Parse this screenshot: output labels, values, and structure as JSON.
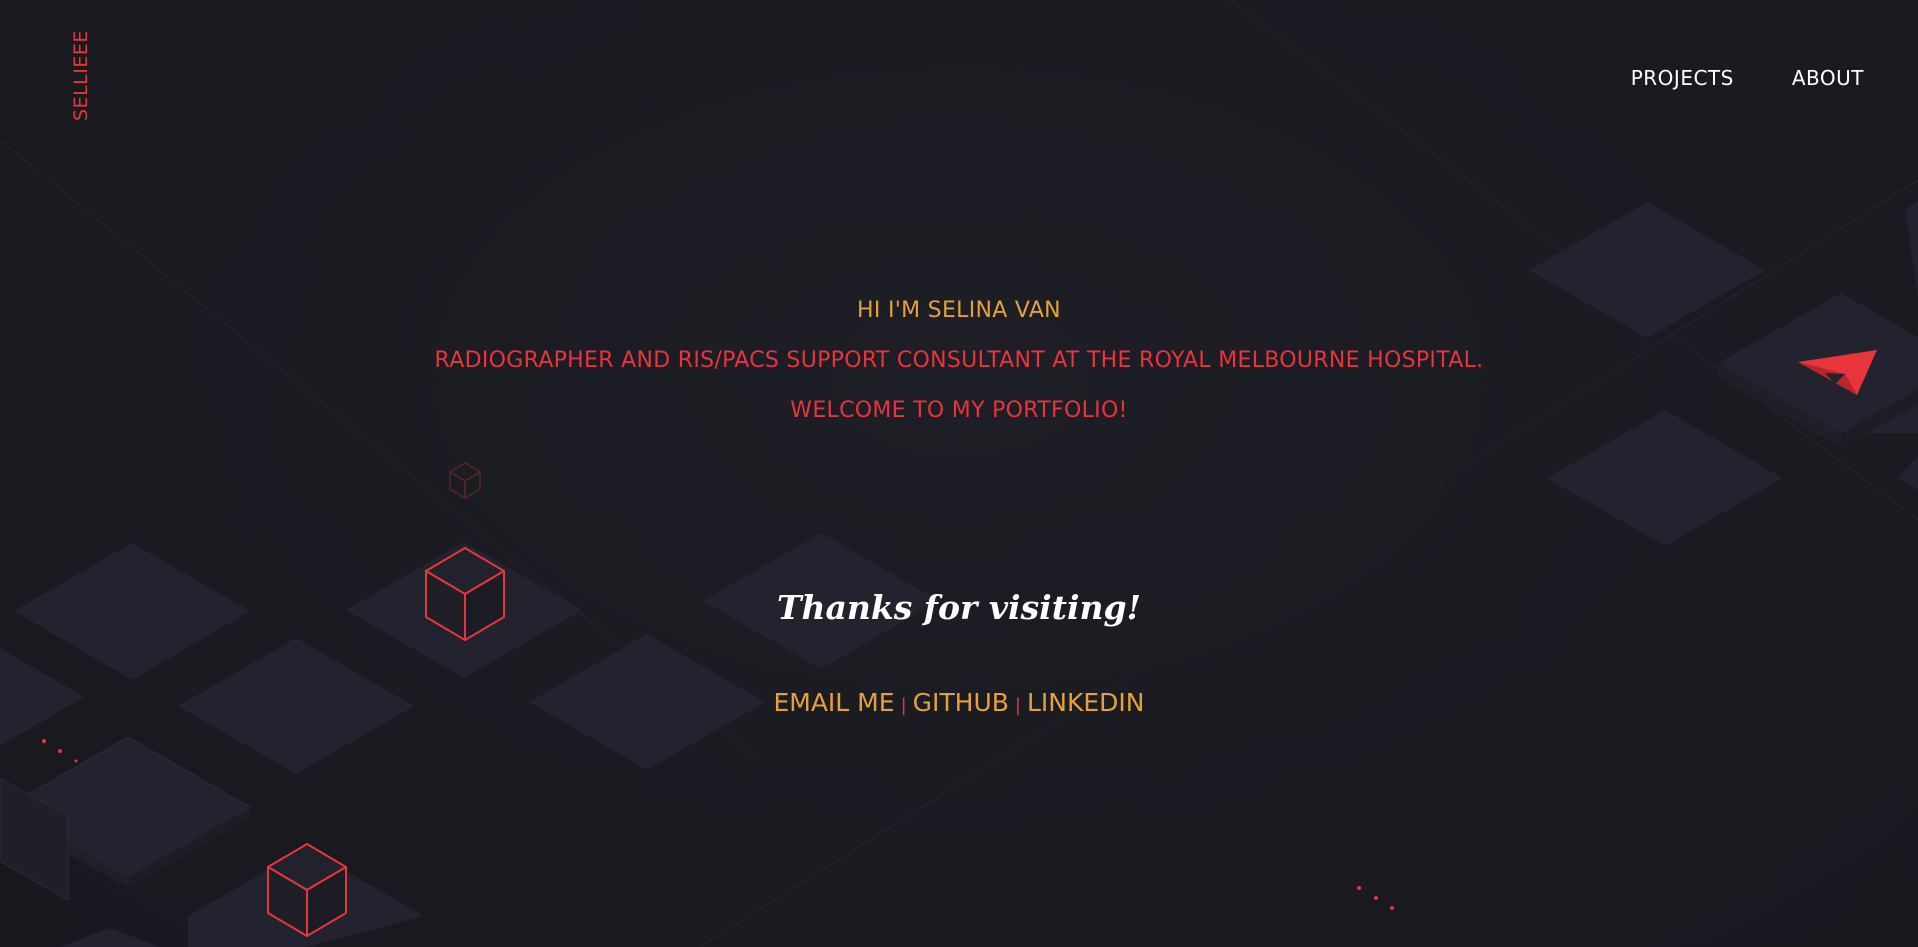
{
  "header": {
    "brand": "SELLIEEE",
    "nav": [
      {
        "label": "PROJECTS"
      },
      {
        "label": "ABOUT"
      }
    ]
  },
  "intro": {
    "greeting": "HI I'M SELINA VAN",
    "role": "RADIOGRAPHER AND RIS/PACS SUPPORT CONSULTANT AT THE ROYAL MELBOURNE HOSPITAL.",
    "welcome": "WELCOME TO MY PORTFOLIO!"
  },
  "thanks": "Thanks for visiting!",
  "contacts": {
    "email": "EMAIL ME",
    "github": "GITHUB",
    "linkedin": "LINKEDIN",
    "separator": "|"
  },
  "colors": {
    "background": "#1b1b22",
    "tile": "#23232f",
    "accent_red": "#e8343b",
    "accent_gold": "#e3a13a",
    "text_white": "#ffffff"
  },
  "icons": [
    "cube-outline-icon",
    "paper-plane-icon"
  ]
}
